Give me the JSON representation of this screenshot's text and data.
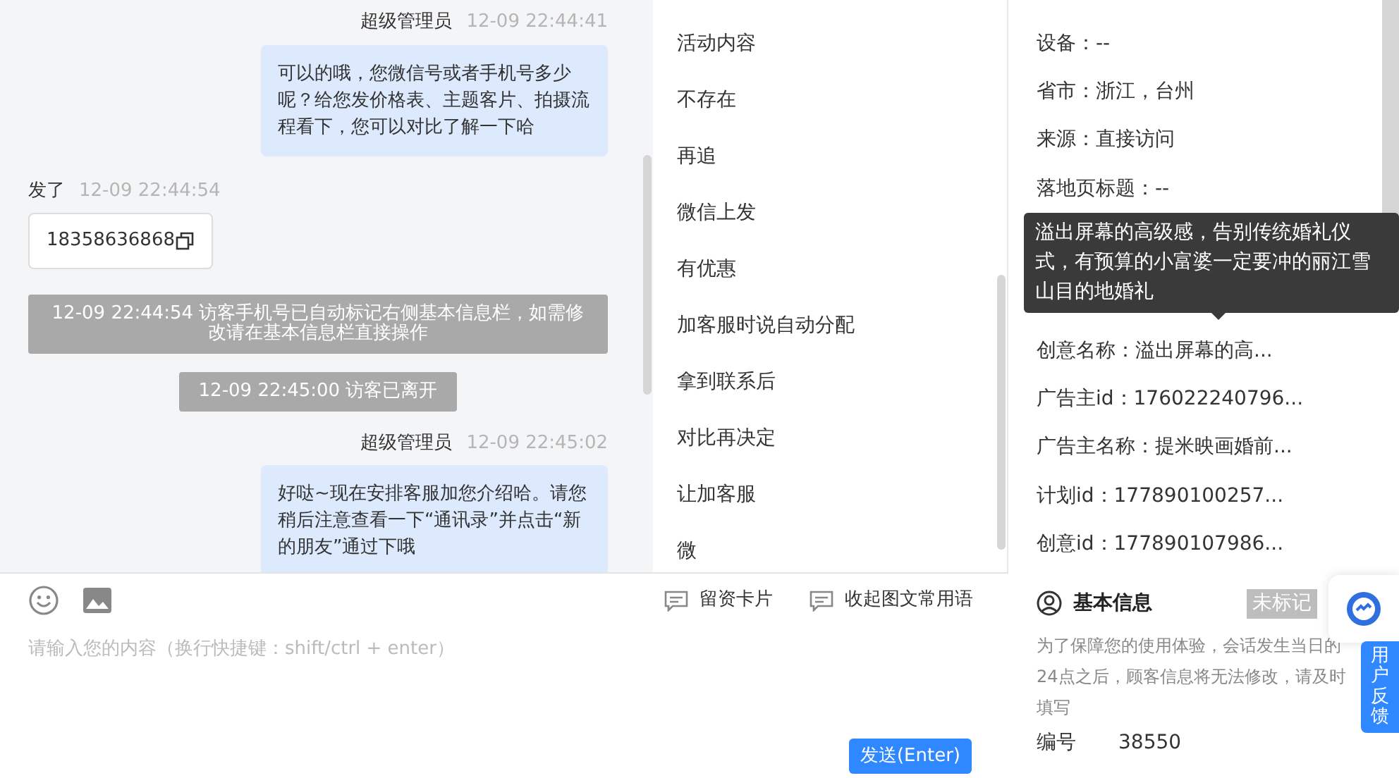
{
  "chat": {
    "messages": [
      {
        "kind": "agent",
        "sender": "超级管理员",
        "time": "12-09 22:44:41",
        "text": "可以的哦，您微信号或者手机号多少呢？给您发价格表、主题客片、拍摄流程看下，您可以对比了解一下哈"
      },
      {
        "kind": "visitor",
        "sender": "发了",
        "time": "12-09 22:44:54",
        "text": "18358636868"
      },
      {
        "kind": "system",
        "text": "12-09 22:44:54 访客手机号已自动标记右侧基本信息栏，如需修改请在基本信息栏直接操作"
      },
      {
        "kind": "system",
        "text": "12-09 22:45:00 访客已离开"
      },
      {
        "kind": "agent",
        "sender": "超级管理员",
        "time": "12-09 22:45:02",
        "text": "好哒~现在安排客服加您介绍哈。请您稍后注意查看一下“通讯录”并点击“新的朋友”通过下哦"
      }
    ]
  },
  "input": {
    "tools": [
      {
        "label": "留资卡片"
      },
      {
        "label": "收起图文常用语"
      }
    ],
    "placeholder": "请输入您的内容（换行快捷键：shift/ctrl + enter）",
    "send_button": "发送(Enter)"
  },
  "quick_replies": [
    "活动内容",
    "不存在",
    "再追",
    "微信上发",
    "有优惠",
    "加客服时说自动分配",
    "拿到联系后",
    "对比再决定",
    "让加客服",
    "微"
  ],
  "visitor_info": {
    "fields_top": [
      "设备：--",
      "省市：浙江，台州",
      "来源：直接访问",
      "落地页标题：--"
    ],
    "tooltip": "溢出屏幕的高级感，告别传统婚礼仪式，有预算的小富婆一定要冲的丽江雪山目的地婚礼",
    "fields_bottom": [
      "创意名称：溢出屏幕的高...",
      "广告主id：176022240796...",
      "广告主名称：提米映画婚前...",
      "计划id：177890100257...",
      "创意id：177890107986..."
    ]
  },
  "basic_info": {
    "title": "基本信息",
    "tag": "未标记",
    "notice": "为了保障您的使用体验，会话发生当日的24点之后，顾客信息将无法修改，请及时填写",
    "fields": [
      {
        "label": "编号",
        "value": "38550"
      }
    ]
  },
  "feedback": {
    "label": "用户反馈"
  }
}
